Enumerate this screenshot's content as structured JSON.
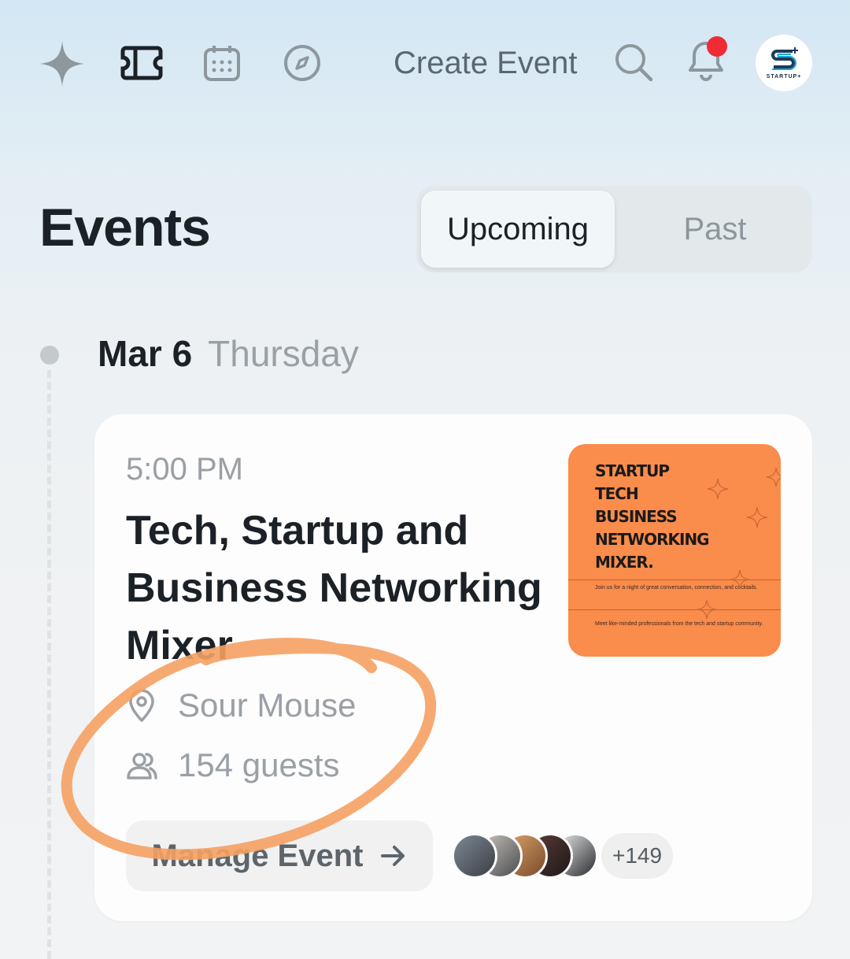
{
  "colors": {
    "accent_orange": "#fa8c4c",
    "notification_dot": "#ef2b36",
    "annotation_stroke": "#f5a163"
  },
  "topbar": {
    "create_event_label": "Create Event",
    "icons": [
      "sparkle-logo-icon",
      "ticket-icon",
      "calendar-icon",
      "compass-icon",
      "search-icon",
      "bell-icon"
    ],
    "has_notification": true,
    "profile_avatar_text": "STARTUP+"
  },
  "header": {
    "title": "Events",
    "tabs": [
      {
        "label": "Upcoming",
        "selected": true
      },
      {
        "label": "Past",
        "selected": false
      }
    ]
  },
  "timeline": {
    "date": "Mar 6",
    "weekday": "Thursday"
  },
  "event": {
    "time": "5:00 PM",
    "title": "Tech, Startup and Business Networking Mixer",
    "location": "Sour Mouse",
    "guests": "154 guests",
    "manage_label": "Manage Event",
    "extra_attendees": "+149",
    "poster": {
      "title_lines": [
        "STARTUP",
        "TECH",
        "BUSINESS",
        "NETWORKING",
        "MIXER."
      ],
      "tagline": "Join us for a night of great conversation, connection, and cocktails.",
      "subline": "Meet like-minded professionals from the tech and startup community."
    }
  }
}
